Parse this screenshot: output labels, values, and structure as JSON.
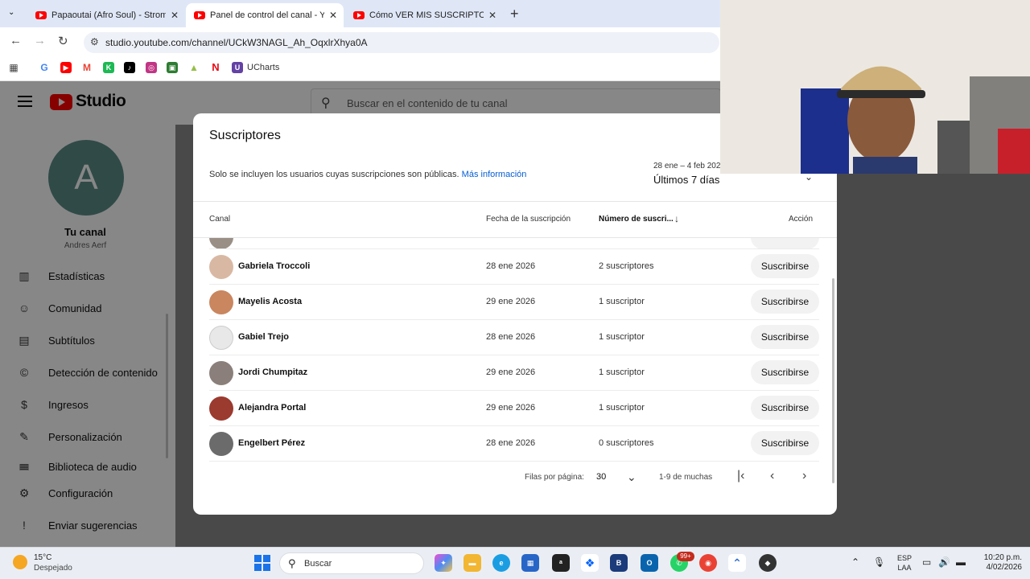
{
  "browser": {
    "tabs": [
      {
        "title": "Papaoutai (Afro Soul) - Stromae",
        "active": false
      },
      {
        "title": "Panel de control del canal - YouTube",
        "active": true
      },
      {
        "title": "Cómo VER MIS SUSCRIPTORES",
        "active": false
      }
    ],
    "url": "studio.youtube.com/channel/UCkW3NAGL_Ah_OqxlrXhya0A",
    "bookmark_label": "UCharts"
  },
  "studio": {
    "logo_text": "Studio",
    "search_placeholder": "Buscar en el contenido de tu canal"
  },
  "sidebar": {
    "avatar_letter": "A",
    "channel_label": "Tu canal",
    "channel_owner": "Andres Aerf",
    "items": [
      {
        "label": "Estadísticas",
        "icon": "chart-icon"
      },
      {
        "label": "Comunidad",
        "icon": "community-icon"
      },
      {
        "label": "Subtítulos",
        "icon": "subtitles-icon"
      },
      {
        "label": "Detección de contenido",
        "icon": "copyright-icon"
      },
      {
        "label": "Ingresos",
        "icon": "dollar-icon"
      },
      {
        "label": "Personalización",
        "icon": "magic-wand-icon"
      },
      {
        "label": "Biblioteca de audio",
        "icon": "audio-library-icon"
      },
      {
        "label": "Configuración",
        "icon": "gear-icon"
      },
      {
        "label": "Enviar sugerencias",
        "icon": "feedback-icon"
      }
    ]
  },
  "modal": {
    "title": "Suscriptores",
    "note": "Solo se incluyen los usuarios cuyas suscripciones son públicas.",
    "note_link": "Más información",
    "range_small": "28 ene – 4 feb 2026",
    "range_label": "Últimos 7 días",
    "columns": {
      "channel": "Canal",
      "date": "Fecha de la suscripción",
      "subs": "Número de suscri...",
      "action": "Acción"
    },
    "rows": [
      {
        "name": "Gabriela Troccoli",
        "date": "28 ene 2026",
        "subs": "2 suscriptores",
        "action": "Suscribirse",
        "avatar_color": "#d9b8a3"
      },
      {
        "name": "Mayelis Acosta",
        "date": "29 ene 2026",
        "subs": "1 suscriptor",
        "action": "Suscribirse",
        "avatar_color": "#c9865f"
      },
      {
        "name": "Gabiel Trejo",
        "date": "28 ene 2026",
        "subs": "1 suscriptor",
        "action": "Suscribirse",
        "avatar_color": "#e8e8e8"
      },
      {
        "name": "Jordi Chumpitaz",
        "date": "29 ene 2026",
        "subs": "1 suscriptor",
        "action": "Suscribirse",
        "avatar_color": "#8a7f7a"
      },
      {
        "name": "Alejandra Portal",
        "date": "29 ene 2026",
        "subs": "1 suscriptor",
        "action": "Suscribirse",
        "avatar_color": "#9b3a2e"
      },
      {
        "name": "Engelbert Pérez",
        "date": "28 ene 2026",
        "subs": "0 suscriptores",
        "action": "Suscribirse",
        "avatar_color": "#6b6b6b"
      }
    ],
    "footer": {
      "rows_label": "Filas por página:",
      "rows_value": "30",
      "range": "1-9 de muchas"
    }
  },
  "taskbar": {
    "temp": "15°C",
    "weather": "Despejado",
    "search": "Buscar",
    "badge": "99+",
    "lang_top": "ESP",
    "lang_bottom": "LAA",
    "time": "10:20 p.m.",
    "date": "4/02/2026"
  },
  "colors": {
    "accent_link": "#065fd4",
    "youtube_red": "#ff0000"
  }
}
